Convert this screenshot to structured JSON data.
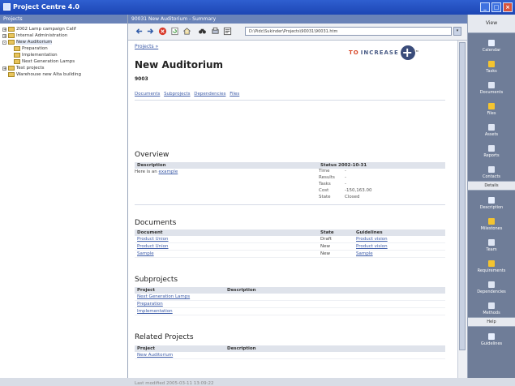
{
  "window": {
    "title": "Project Centre 4.0"
  },
  "left_pane": {
    "header": "Projects",
    "tree": [
      {
        "label": "2002 Lamp campaign Calif",
        "level": 0,
        "expander": "+"
      },
      {
        "label": "Internal Administration",
        "level": 0,
        "expander": "+"
      },
      {
        "label": "New Auditorium",
        "level": 0,
        "expander": "-",
        "selected": true
      },
      {
        "label": "Preparation",
        "level": 1,
        "expander": ""
      },
      {
        "label": "Implementation",
        "level": 1,
        "expander": ""
      },
      {
        "label": "Next Generation Lamps",
        "level": 1,
        "expander": ""
      },
      {
        "label": "Test projects",
        "level": 0,
        "expander": "+"
      },
      {
        "label": "Warehouse new Alta building",
        "level": 0,
        "expander": ""
      }
    ]
  },
  "center_pane": {
    "header": "90031 New Auditorium - Summary",
    "address": "D:\\Pidc\\Sukinder\\Projects\\90031\\90031.htm",
    "breadcrumb": "Projects »",
    "logo": {
      "part1": "TO",
      "part2": "INCREASE",
      "tm": "TM"
    },
    "title": "New Auditorium",
    "project_number": "9003",
    "subnav": [
      "Documents",
      "Subprojects",
      "Dependencies",
      "Files"
    ],
    "overview": {
      "heading": "Overview",
      "col1": "Description",
      "col2": "Status 2002-10-31",
      "desc_prefix": "Here is an",
      "desc_link": "example",
      "fields": [
        {
          "key": "Time",
          "value": "-"
        },
        {
          "key": "Results",
          "value": "-"
        },
        {
          "key": "Tasks",
          "value": "-"
        },
        {
          "key": "Cost",
          "value": "-150,163.00"
        },
        {
          "key": "State",
          "value": "Closed"
        }
      ]
    },
    "documents": {
      "heading": "Documents",
      "columns": [
        "Document",
        "State",
        "Guidelines"
      ],
      "rows": [
        [
          "Product Union",
          "Draft",
          "Product vision"
        ],
        [
          "Product Union",
          "New",
          "Product vision"
        ],
        [
          "Sample",
          "New",
          "Sample"
        ]
      ]
    },
    "subprojects": {
      "heading": "Subprojects",
      "columns": [
        "Project",
        "Description"
      ],
      "rows": [
        [
          "Next Generation Lamps",
          ""
        ],
        [
          "Preparation",
          ""
        ],
        [
          "Implementation",
          ""
        ]
      ]
    },
    "related": {
      "heading": "Related Projects",
      "columns": [
        "Project",
        "Description"
      ],
      "rows": [
        [
          "New Auditorium",
          ""
        ]
      ]
    },
    "footer": "Last modified 2005-03-11 13:09:22"
  },
  "right_pane": {
    "header": "View",
    "view_items": [
      "Calendar",
      "Tasks",
      "Documents",
      "Files",
      "Assets",
      "Reports",
      "Contacts"
    ],
    "details_header": "Details",
    "detail_items": [
      "Description",
      "Milestones",
      "Team",
      "Requirements",
      "Dependencies",
      "Methods"
    ],
    "help_header": "Help",
    "help_items": [
      "Guidelines"
    ]
  },
  "colors": {
    "titlebar": "#1d46b4",
    "panel_header": "#6a83b8",
    "sidebar": "#6f7d98",
    "link": "#3c5ba8",
    "logo_accent": "#d8492a"
  }
}
